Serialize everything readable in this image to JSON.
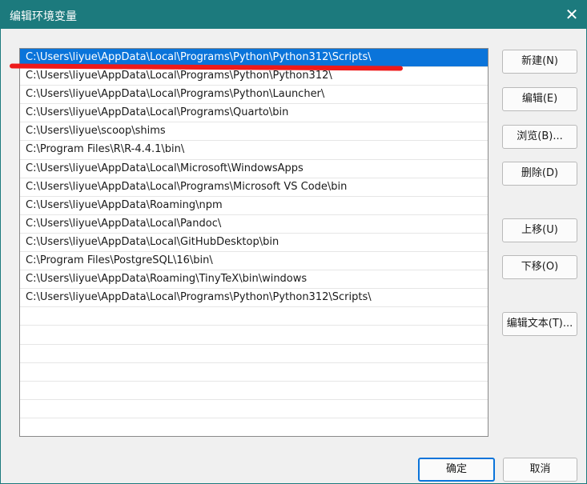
{
  "window": {
    "title": "编辑环境变量",
    "close_label": "✕"
  },
  "path_list": [
    "C:\\Users\\liyue\\AppData\\Local\\Programs\\Python\\Python312\\Scripts\\",
    "C:\\Users\\liyue\\AppData\\Local\\Programs\\Python\\Python312\\",
    "C:\\Users\\liyue\\AppData\\Local\\Programs\\Python\\Launcher\\",
    "C:\\Users\\liyue\\AppData\\Local\\Programs\\Quarto\\bin",
    "C:\\Users\\liyue\\scoop\\shims",
    "C:\\Program Files\\R\\R-4.4.1\\bin\\",
    "C:\\Users\\liyue\\AppData\\Local\\Microsoft\\WindowsApps",
    "C:\\Users\\liyue\\AppData\\Local\\Programs\\Microsoft VS Code\\bin",
    "C:\\Users\\liyue\\AppData\\Roaming\\npm",
    "C:\\Users\\liyue\\AppData\\Local\\Pandoc\\",
    "C:\\Users\\liyue\\AppData\\Local\\GitHubDesktop\\bin",
    "C:\\Program Files\\PostgreSQL\\16\\bin\\",
    "C:\\Users\\liyue\\AppData\\Roaming\\TinyTeX\\bin\\windows",
    "C:\\Users\\liyue\\AppData\\Local\\Programs\\Python\\Python312\\Scripts\\",
    "",
    "",
    "",
    "",
    "",
    "",
    "",
    ""
  ],
  "selected_index": 0,
  "buttons": {
    "new": "新建(N)",
    "edit": "编辑(E)",
    "browse": "浏览(B)...",
    "delete": "删除(D)",
    "move_up": "上移(U)",
    "move_down": "下移(O)",
    "edit_text": "编辑文本(T)...",
    "ok": "确定",
    "cancel": "取消"
  },
  "colors": {
    "titlebar": "#1c7a7d",
    "selection": "#0a74da",
    "annotation_underline": "#ee1a1a"
  }
}
